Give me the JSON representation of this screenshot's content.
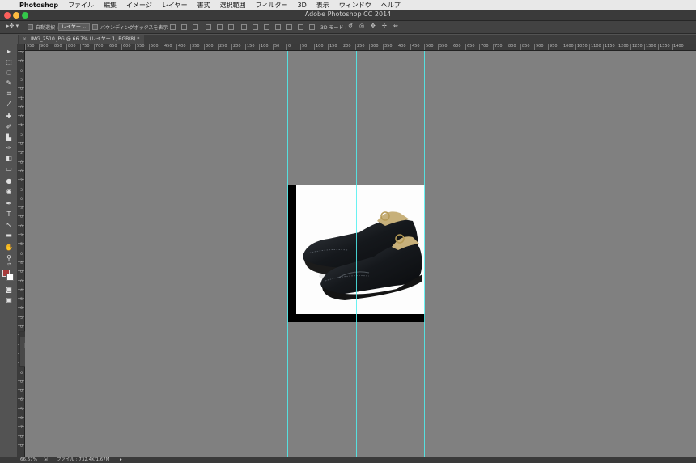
{
  "menubar": {
    "items": [
      "Photoshop",
      "ファイル",
      "編集",
      "イメージ",
      "レイヤー",
      "書式",
      "選択範囲",
      "フィルター",
      "3D",
      "表示",
      "ウィンドウ",
      "ヘルプ"
    ]
  },
  "window": {
    "title": "Adobe Photoshop CC 2014"
  },
  "options": {
    "auto_select_label": "自動選択 :",
    "auto_select_value": "レイヤー",
    "bounding_box_label": "バウンディングボックスを表示",
    "mode_3d_label": "3D モード :"
  },
  "document": {
    "tab_title": "IMG_2510.JPG @ 66.7% (レイヤー 1, RGB/8) *",
    "tab_close": "×"
  },
  "ruler": {
    "h_labels": [
      "950",
      "900",
      "850",
      "800",
      "750",
      "700",
      "650",
      "600",
      "550",
      "500",
      "450",
      "400",
      "350",
      "300",
      "250",
      "200",
      "150",
      "100",
      "50",
      "0",
      "50",
      "100",
      "150",
      "200",
      "250",
      "300",
      "350",
      "400",
      "450",
      "500",
      "550",
      "600",
      "650",
      "700",
      "750",
      "800",
      "850",
      "900",
      "950",
      "1000",
      "1050",
      "1100",
      "1150",
      "1200",
      "1250",
      "1300",
      "1350",
      "1400"
    ],
    "v_labels": [
      "5",
      "0",
      "0",
      "5",
      "0",
      "1",
      "0",
      "0",
      "1",
      "5",
      "0",
      "2",
      "0",
      "0",
      "2",
      "5",
      "0",
      "3",
      "0",
      "0",
      "3",
      "5",
      "0",
      "4",
      "0",
      "0",
      "4",
      "5",
      "0",
      "5",
      "0",
      "0",
      "5",
      "5",
      "0",
      "6",
      "0",
      "0",
      "6",
      "5",
      "0",
      "7",
      "0",
      "0"
    ]
  },
  "status": {
    "zoom": "66.67%",
    "file_info": "ファイル : 732.4K/1.67M"
  },
  "colors": {
    "foreground": "#a83c3c",
    "background": "#ffffff",
    "canvas_bg": "#808080",
    "guide": "#4ff0f0"
  },
  "tools": [
    "move-icon",
    "marquee-icon",
    "lasso-icon",
    "quick-select-icon",
    "crop-icon",
    "eyedropper-icon",
    "healing-icon",
    "brush-icon",
    "stamp-icon",
    "history-brush-icon",
    "eraser-icon",
    "gradient-icon",
    "blur-icon",
    "dodge-icon",
    "pen-icon",
    "type-icon",
    "path-select-icon",
    "shape-icon",
    "hand-icon",
    "zoom-icon"
  ]
}
